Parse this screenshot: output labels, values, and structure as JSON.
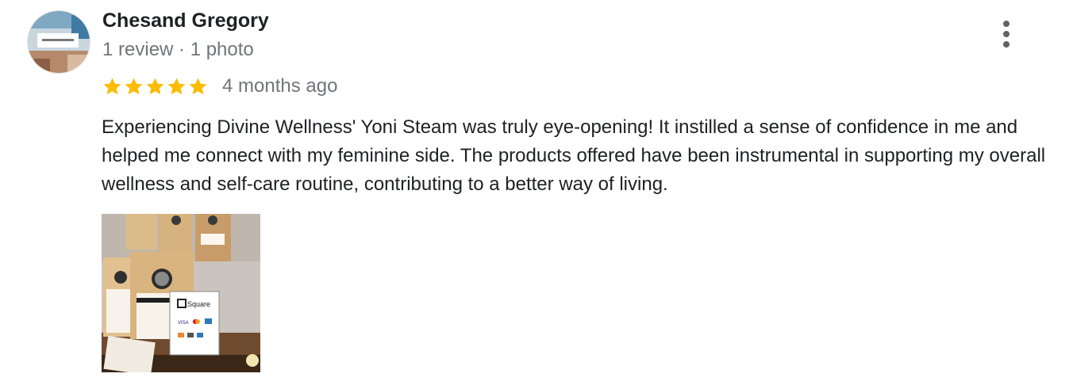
{
  "review": {
    "reviewer_name": "Chesand Gregory",
    "reviewer_meta": "1 review · 1 photo",
    "rating": 5,
    "rating_max": 5,
    "date": "4 months ago",
    "text": "Experiencing Divine Wellness' Yoni Steam was truly eye-opening! It instilled a sense of confidence in me and helped me connect with my feminine side. The products offered have been instrumental in supporting my overall wellness and self-care routine, contributing to a better way of living.",
    "photo_sign_text": "Square",
    "photo_card_text": "VISA",
    "more_icon": "more-vert-icon",
    "star_icon": "star-icon"
  },
  "colors": {
    "star": "#fbbc04",
    "meta": "#70757a",
    "text": "#202124",
    "icon": "#5f6368"
  }
}
